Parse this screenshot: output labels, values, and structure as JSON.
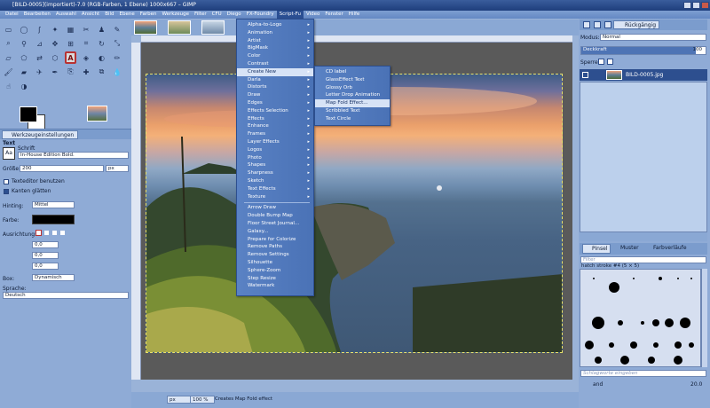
{
  "window": {
    "title": "[BILD-0005](importiert)-7.0 (RGB-Farben, 1 Ebene) 1000x667 – GIMP"
  },
  "menubar": [
    "Datei",
    "Bearbeiten",
    "Auswahl",
    "Ansicht",
    "Bild",
    "Ebene",
    "Farben",
    "Werkzeuge",
    "Filter",
    "CFU",
    "Diego",
    "FX-Foundry",
    "Script-Fu",
    "Video",
    "Fenster",
    "Hilfe"
  ],
  "toolbox": {
    "tool_options_tab": "Werkzeugeinstellungen",
    "tool_name": "Text",
    "font_label": "Schrift",
    "font_value": "In-House Edition Bold.",
    "size_label": "Größe:",
    "size_value": "200",
    "size_unit": "px",
    "text_editor_label": "Texteditor benutzen",
    "antialias_label": "Kanten glätten",
    "hinting_label": "Hinting:",
    "hinting_value": "Mittel",
    "color_label": "Farbe:",
    "justify_label": "Ausrichtung:",
    "indent_value": "0,0",
    "line_spacing_value": "0,0",
    "letter_spacing_value": "0,0",
    "box_label": "Box:",
    "box_value": "Dynamisch",
    "language_label": "Sprache:",
    "language_value": "Deutsch",
    "fg_color": "#000000",
    "bg_color": "#ffffff"
  },
  "scriptfu_menu": {
    "items": [
      "Alpha-to-Logo",
      "Animation",
      "Artist",
      "BigMask",
      "Color",
      "Contrast",
      "Create New",
      "Darla",
      "Distorts",
      "Draw",
      "Edges",
      "Effects Selection",
      "Effects",
      "Enhance",
      "Frames",
      "Layer Effects",
      "Logos",
      "Photo",
      "Shapes",
      "Sharpness",
      "Sketch",
      "Text Effects",
      "Texture"
    ],
    "plain_items": [
      "Arrow Draw",
      "Double Bump Map",
      "Floor Street Journal...",
      "Galaxy...",
      "Prepare for Colorize",
      "Remove Paths",
      "Remove Settings",
      "Silhouette",
      "Sphere-Zoom",
      "Step Resize",
      "Watermark"
    ],
    "highlighted": "Create New"
  },
  "create_new_submenu": {
    "items": [
      "CD label",
      "GlassEffect Text",
      "Glossy Orb",
      "Letter Drop Animation",
      "Map Fold Effect...",
      "Scribbled Text",
      "Text Circle"
    ],
    "highlighted": "Map Fold Effect..."
  },
  "statusbar": {
    "unit": "px",
    "zoom": "100 %",
    "message": "Creates Map Fold effect"
  },
  "dock": {
    "undo_tab": "Rückgängig",
    "mode_label": "Modus:",
    "mode_value": "Normal",
    "opacity_label": "Deckkraft",
    "opacity_value": "100",
    "lock_label": "Sperre:",
    "layer_name": "BILD-0005.jpg",
    "brush_tab": "Pinsel",
    "pattern_tab": "Muster",
    "gradient_tab": "Farbverläufe",
    "filter_label": "Filter",
    "brush_name": "hatch stroke #4 (5 × 5)",
    "tag_placeholder": "Schlagworte eingeben",
    "spacing_label": "and",
    "spacing_value": "20.0"
  },
  "colors": {
    "accent": "#2d4f8f",
    "menu_bg": "#5a82c4",
    "highlight": "#d7e3f6"
  }
}
